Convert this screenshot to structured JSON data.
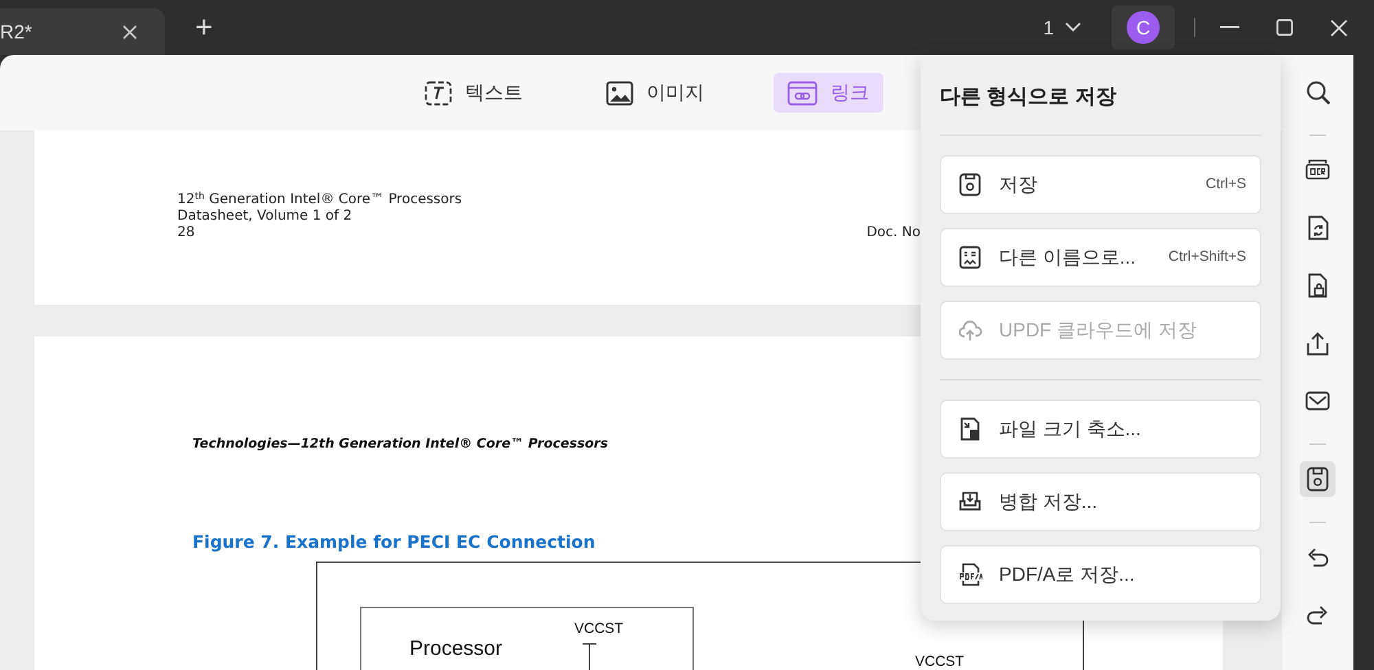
{
  "tabs": [
    {
      "label": "R2*",
      "selected": true
    }
  ],
  "new_tab": "+",
  "page_indicator": "1",
  "avatar": "C",
  "toolbar": [
    {
      "label": "텍스트",
      "kind": "text",
      "selected": false
    },
    {
      "label": "이미지",
      "kind": "image",
      "selected": false
    },
    {
      "label": "링크",
      "kind": "link",
      "selected": true
    }
  ],
  "document": {
    "page_1": {
      "lines": [
        "12$^{th}$ Generation Intel® Core™ Processors",
        "Datasheet, Volume 1 of 2",
        "28"
      ],
      "doc_no": "Doc. No"
    },
    "page_2": {
      "header": "Technologies—12th Generation Intel® Core™ Processors",
      "figure_title": "Figure 7. Example for PECI EC Connection",
      "diagram_labels": [
        "Processor",
        "VCCST",
        "VCCST"
      ]
    }
  },
  "save_panel": {
    "title": "다른 형식으로 저장",
    "groups": [
      [
        {
          "label": "저장",
          "shortcut": "Ctrl+S",
          "kind": "save",
          "disabled": false
        },
        {
          "label": "다른 이름으로...",
          "shortcut": "Ctrl+Shift+S",
          "kind": "save_as",
          "disabled": false
        },
        {
          "label": "UPDF 클라우드에 저장",
          "kind": "cloud",
          "disabled": true
        }
      ],
      [
        {
          "label": "파일 크기 축소...",
          "kind": "reduce",
          "disabled": false
        },
        {
          "label": "병합 저장...",
          "kind": "flatten",
          "disabled": false
        },
        {
          "label": "PDF/A로 저장...",
          "kind": "pdfa",
          "disabled": false
        }
      ]
    ]
  },
  "sidebar": [
    [
      {
        "kind": "search",
        "selected": false
      }
    ],
    [
      {
        "kind": "ocr",
        "selected": false
      },
      {
        "kind": "convert",
        "selected": false
      },
      {
        "kind": "protect",
        "selected": false
      },
      {
        "kind": "share",
        "selected": false
      },
      {
        "kind": "email",
        "selected": false
      }
    ],
    [
      {
        "kind": "save",
        "selected": true
      }
    ],
    [
      {
        "kind": "undo",
        "selected": false
      },
      {
        "kind": "redo",
        "selected": false
      }
    ]
  ]
}
